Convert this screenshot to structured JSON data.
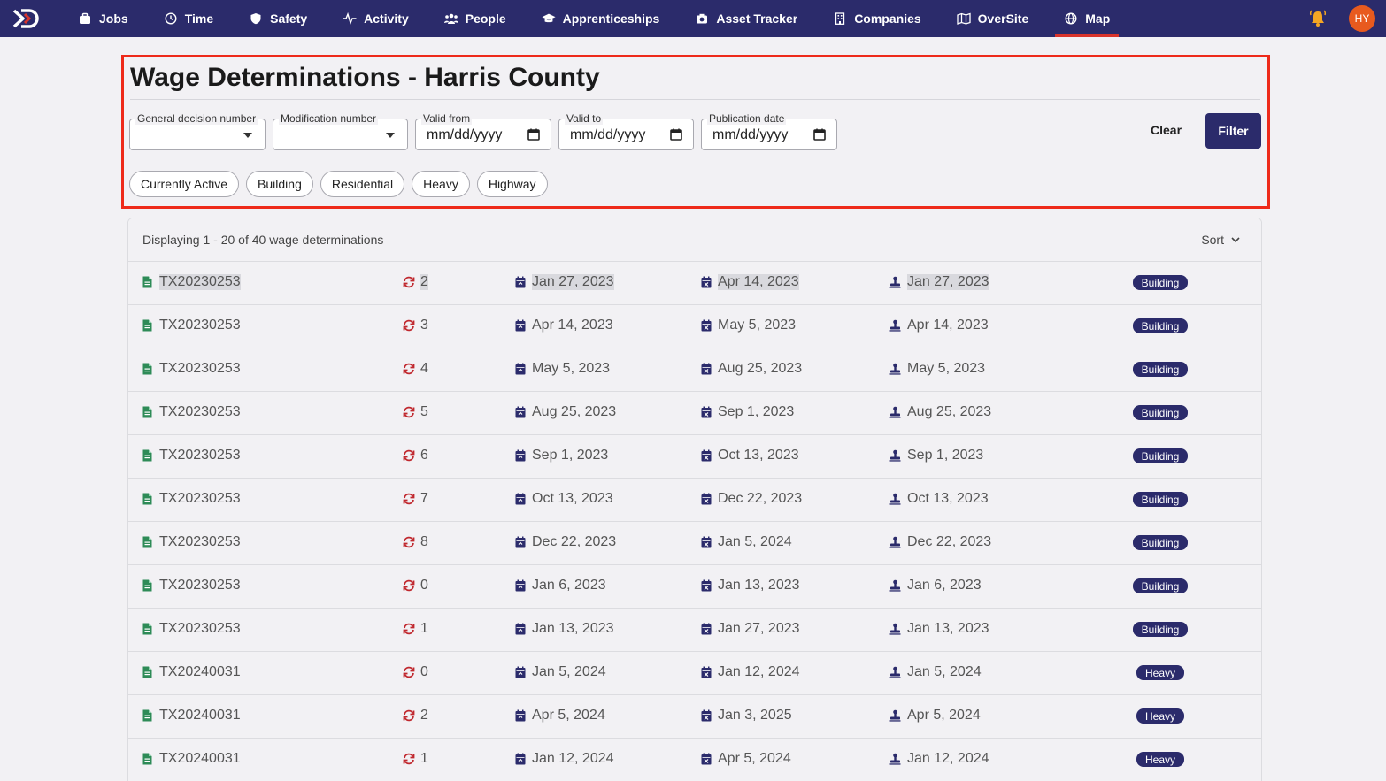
{
  "nav": {
    "items": [
      {
        "label": "Jobs",
        "icon": "briefcase-icon"
      },
      {
        "label": "Time",
        "icon": "clock-icon"
      },
      {
        "label": "Safety",
        "icon": "shield-icon"
      },
      {
        "label": "Activity",
        "icon": "pulse-icon"
      },
      {
        "label": "People",
        "icon": "people-icon"
      },
      {
        "label": "Apprenticeships",
        "icon": "graduation-cap-icon"
      },
      {
        "label": "Asset Tracker",
        "icon": "camera-icon"
      },
      {
        "label": "Companies",
        "icon": "building-icon"
      },
      {
        "label": "OverSite",
        "icon": "map-icon"
      },
      {
        "label": "Map",
        "icon": "globe-icon"
      }
    ],
    "active": "Map",
    "avatar_initials": "HY"
  },
  "page": {
    "title": "Wage Determinations - Harris County"
  },
  "filters": {
    "general_decision_label": "General decision number",
    "modification_label": "Modification number",
    "valid_from_label": "Valid from",
    "valid_to_label": "Valid to",
    "publication_label": "Publication date",
    "date_placeholder": "mm/dd/yyyy",
    "clear_label": "Clear",
    "filter_label": "Filter",
    "chips": [
      "Currently Active",
      "Building",
      "Residential",
      "Heavy",
      "Highway"
    ]
  },
  "list": {
    "summary": "Displaying 1 - 20 of 40 wage determinations",
    "sort_label": "Sort",
    "rows": [
      {
        "id": "TX20230253",
        "mod": "2",
        "start": "Jan 27, 2023",
        "end": "Apr 14, 2023",
        "pub": "Jan 27, 2023",
        "type": "Building"
      },
      {
        "id": "TX20230253",
        "mod": "3",
        "start": "Apr 14, 2023",
        "end": "May 5, 2023",
        "pub": "Apr 14, 2023",
        "type": "Building"
      },
      {
        "id": "TX20230253",
        "mod": "4",
        "start": "May 5, 2023",
        "end": "Aug 25, 2023",
        "pub": "May 5, 2023",
        "type": "Building"
      },
      {
        "id": "TX20230253",
        "mod": "5",
        "start": "Aug 25, 2023",
        "end": "Sep 1, 2023",
        "pub": "Aug 25, 2023",
        "type": "Building"
      },
      {
        "id": "TX20230253",
        "mod": "6",
        "start": "Sep 1, 2023",
        "end": "Oct 13, 2023",
        "pub": "Sep 1, 2023",
        "type": "Building"
      },
      {
        "id": "TX20230253",
        "mod": "7",
        "start": "Oct 13, 2023",
        "end": "Dec 22, 2023",
        "pub": "Oct 13, 2023",
        "type": "Building"
      },
      {
        "id": "TX20230253",
        "mod": "8",
        "start": "Dec 22, 2023",
        "end": "Jan 5, 2024",
        "pub": "Dec 22, 2023",
        "type": "Building"
      },
      {
        "id": "TX20230253",
        "mod": "0",
        "start": "Jan 6, 2023",
        "end": "Jan 13, 2023",
        "pub": "Jan 6, 2023",
        "type": "Building"
      },
      {
        "id": "TX20230253",
        "mod": "1",
        "start": "Jan 13, 2023",
        "end": "Jan 27, 2023",
        "pub": "Jan 13, 2023",
        "type": "Building"
      },
      {
        "id": "TX20240031",
        "mod": "0",
        "start": "Jan 5, 2024",
        "end": "Jan 12, 2024",
        "pub": "Jan 5, 2024",
        "type": "Heavy"
      },
      {
        "id": "TX20240031",
        "mod": "2",
        "start": "Apr 5, 2024",
        "end": "Jan 3, 2025",
        "pub": "Apr 5, 2024",
        "type": "Heavy"
      },
      {
        "id": "TX20240031",
        "mod": "1",
        "start": "Jan 12, 2024",
        "end": "Apr 5, 2024",
        "pub": "Jan 12, 2024",
        "type": "Heavy"
      }
    ]
  },
  "colors": {
    "nav_bg": "#2b2b6b",
    "highlight_border": "#ee2a1a",
    "file_icon": "#2e8b57",
    "mod_icon": "#c0282e",
    "date_icon": "#2b2b6b",
    "avatar_bg": "#e85a1e",
    "bell": "#f5a623"
  }
}
